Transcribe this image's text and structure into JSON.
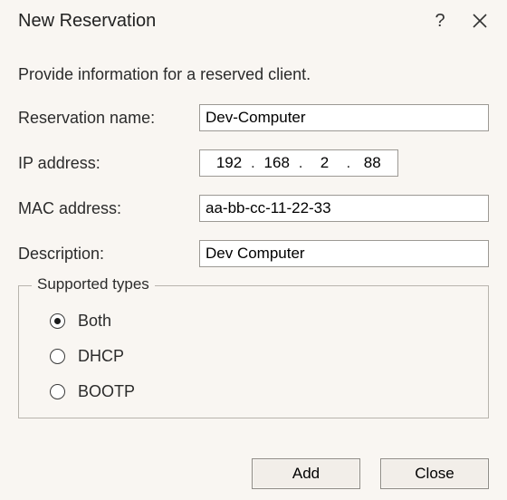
{
  "window": {
    "title": "New Reservation"
  },
  "intro": "Provide information for a reserved client.",
  "fields": {
    "name_label": "Reservation name:",
    "name_value": "Dev-Computer",
    "ip_label": "IP address:",
    "ip": {
      "o1": "192",
      "o2": "168",
      "o3": "2",
      "o4": "88"
    },
    "mac_label": "MAC address:",
    "mac_value": "aa-bb-cc-11-22-33",
    "desc_label": "Description:",
    "desc_value": "Dev Computer"
  },
  "group": {
    "legend": "Supported types",
    "options": {
      "both": {
        "label": "Both",
        "selected": true
      },
      "dhcp": {
        "label": "DHCP",
        "selected": false
      },
      "bootp": {
        "label": "BOOTP",
        "selected": false
      }
    }
  },
  "buttons": {
    "add": "Add",
    "close": "Close"
  },
  "icons": {
    "help": "?",
    "close": "close"
  }
}
